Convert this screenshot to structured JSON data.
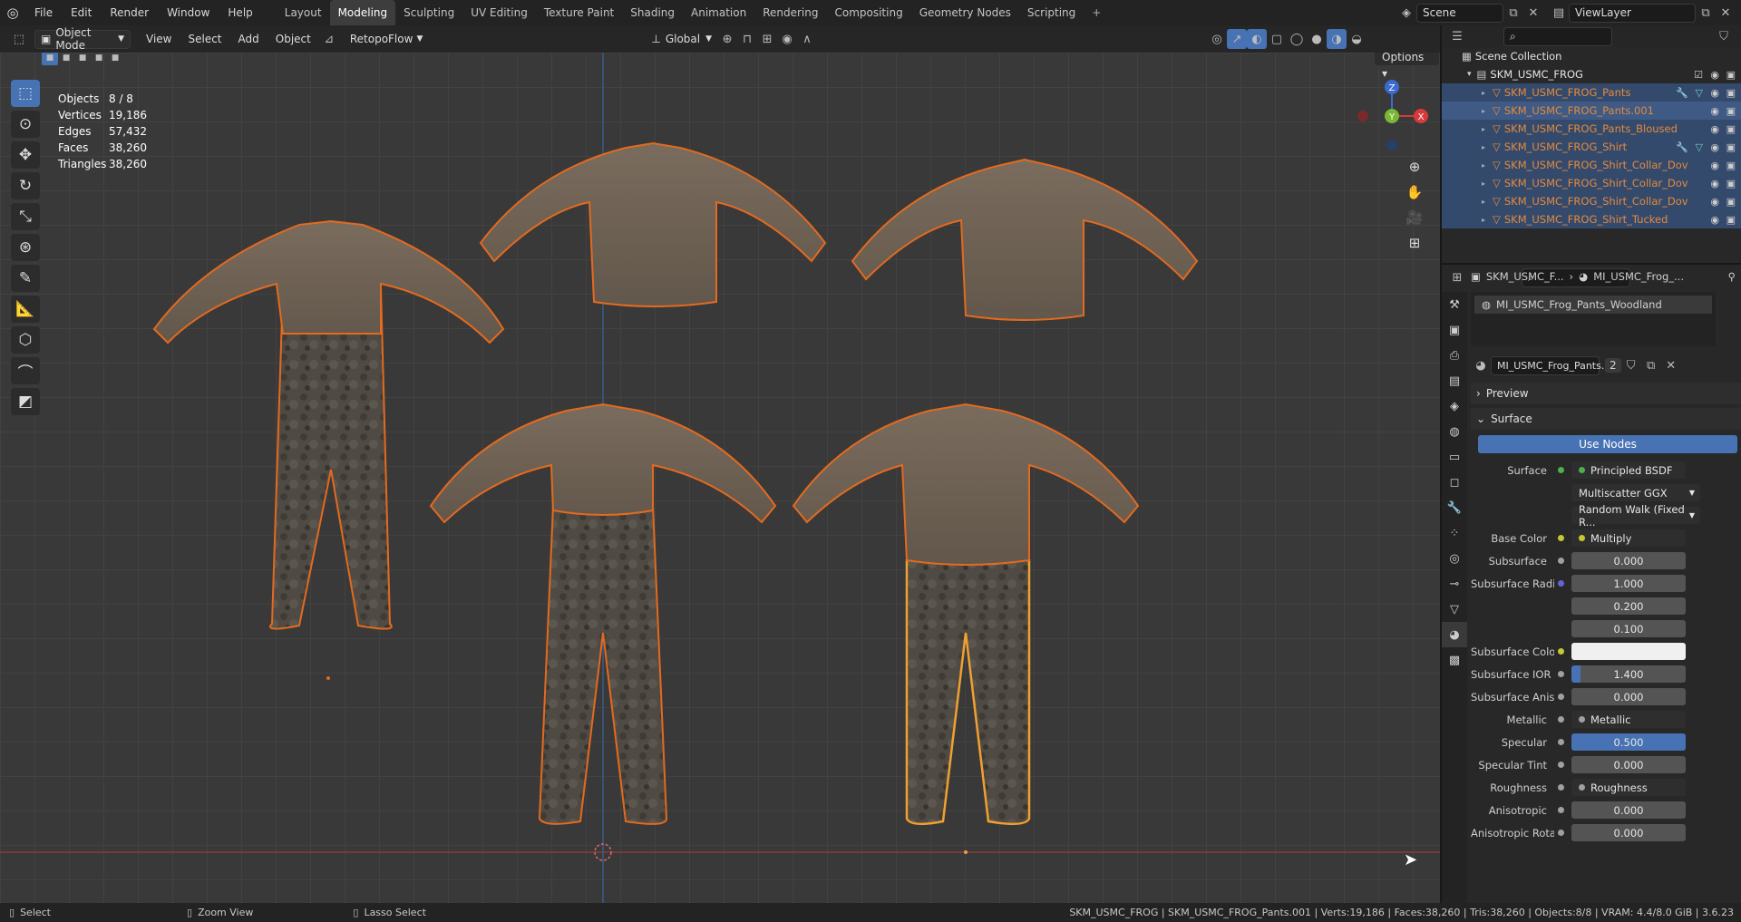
{
  "topbar": {
    "menu": [
      "File",
      "Edit",
      "Render",
      "Window",
      "Help"
    ],
    "workspaces": [
      "Layout",
      "Modeling",
      "Sculpting",
      "UV Editing",
      "Texture Paint",
      "Shading",
      "Animation",
      "Rendering",
      "Compositing",
      "Geometry Nodes",
      "Scripting",
      "+"
    ],
    "active_workspace": "Modeling",
    "scene": "Scene",
    "view_layer": "ViewLayer"
  },
  "viewport_header": {
    "mode": "Object Mode",
    "menus": [
      "View",
      "Select",
      "Add",
      "Object"
    ],
    "addon": "RetopoFlow",
    "transform_orientation": "Global",
    "options": "Options"
  },
  "stats": [
    {
      "k": "Objects",
      "v": "8 / 8"
    },
    {
      "k": "Vertices",
      "v": "19,186"
    },
    {
      "k": "Edges",
      "v": "57,432"
    },
    {
      "k": "Faces",
      "v": "38,260"
    },
    {
      "k": "Triangles",
      "v": "38,260"
    }
  ],
  "gizmo": {
    "z": "Z",
    "y": "Y",
    "x": "X"
  },
  "outliner": {
    "root": "Scene Collection",
    "collection": "SKM_USMC_FROG",
    "items": [
      {
        "name": "SKM_USMC_FROG_Pants",
        "selected": true,
        "mods": true
      },
      {
        "name": "SKM_USMC_FROG_Pants.001",
        "selected": true,
        "mods": false,
        "active": true
      },
      {
        "name": "SKM_USMC_FROG_Pants_Bloused",
        "selected": true,
        "mods": false
      },
      {
        "name": "SKM_USMC_FROG_Shirt",
        "selected": true,
        "mods": true
      },
      {
        "name": "SKM_USMC_FROG_Shirt_Collar_Dov",
        "selected": true,
        "mods": false
      },
      {
        "name": "SKM_USMC_FROG_Shirt_Collar_Dov",
        "selected": true,
        "mods": false
      },
      {
        "name": "SKM_USMC_FROG_Shirt_Collar_Dov",
        "selected": true,
        "mods": false
      },
      {
        "name": "SKM_USMC_FROG_Shirt_Tucked",
        "selected": true,
        "mods": false
      }
    ]
  },
  "properties": {
    "breadcrumb_obj": "SKM_USMC_F...",
    "breadcrumb_mat": "MI_USMC_Frog_...",
    "slot": "MI_USMC_Frog_Pants_Woodland",
    "material": "MI_USMC_Frog_Pants...",
    "users": "2",
    "preview": "Preview",
    "surface_section": "Surface",
    "use_nodes": "Use Nodes",
    "rows": [
      {
        "label": "Surface",
        "value": "Principled BSDF",
        "kind": "dark",
        "dot": "#4caf50"
      },
      {
        "label": "",
        "value": "Multiscatter GGX",
        "kind": "dd"
      },
      {
        "label": "",
        "value": "Random Walk (Fixed R...",
        "kind": "dd"
      },
      {
        "label": "Base Color",
        "value": "Multiply",
        "kind": "dark",
        "dot": "#c8c832",
        "arrow": true
      },
      {
        "label": "Subsurface",
        "value": "0.000",
        "kind": "num"
      },
      {
        "label": "Subsurface Radius",
        "value": "1.000",
        "kind": "num",
        "dot": "#6464d8"
      },
      {
        "label": "",
        "value": "0.200",
        "kind": "num",
        "nodot": true
      },
      {
        "label": "",
        "value": "0.100",
        "kind": "num",
        "nodot": true
      },
      {
        "label": "Subsurface Color",
        "value": "",
        "kind": "white",
        "dot": "#c8c832"
      },
      {
        "label": "Subsurface IOR",
        "value": "1.400",
        "kind": "num",
        "fill": 0.08
      },
      {
        "label": "Subsurface Aniso...",
        "value": "0.000",
        "kind": "num"
      },
      {
        "label": "Metallic",
        "value": "Metallic",
        "kind": "dark",
        "arrow": true
      },
      {
        "label": "Specular",
        "value": "0.500",
        "kind": "blue"
      },
      {
        "label": "Specular Tint",
        "value": "0.000",
        "kind": "num"
      },
      {
        "label": "Roughness",
        "value": "Roughness",
        "kind": "dark",
        "arrow": true
      },
      {
        "label": "Anisotropic",
        "value": "0.000",
        "kind": "num"
      },
      {
        "label": "Anisotropic Rota...",
        "value": "0.000",
        "kind": "num"
      }
    ]
  },
  "status": {
    "select": "Select",
    "zoom": "Zoom View",
    "lasso": "Lasso Select",
    "info": "SKM_USMC_FROG | SKM_USMC_FROG_Pants.001 | Verts:19,186 | Faces:38,260 | Tris:38,260 | Objects:8/8 | VRAM: 4.4/8.0 GiB | 3.6.23"
  }
}
